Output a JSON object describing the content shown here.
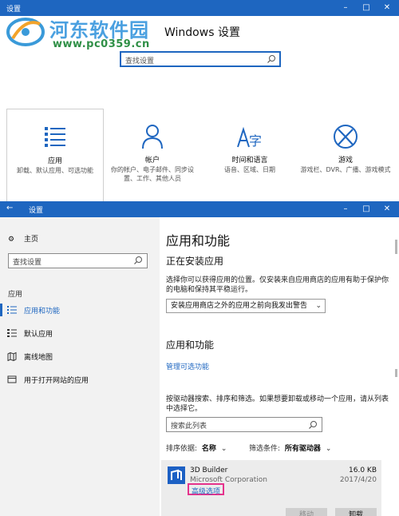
{
  "window1": {
    "title": "设置",
    "heading": "Windows 设置",
    "search_placeholder": "查找设置",
    "categories": [
      {
        "name": "应用",
        "desc": "卸载、默认应用、可选功能",
        "icon": "apps-list-icon"
      },
      {
        "name": "帐户",
        "desc": "你的帐户、电子邮件、同步设置、工作、其他人员",
        "icon": "person-icon"
      },
      {
        "name": "时间和语言",
        "desc": "语音、区域、日期",
        "icon": "time-language-icon"
      },
      {
        "name": "游戏",
        "desc": "游戏栏、DVR、广播、游戏模式",
        "icon": "xbox-icon"
      }
    ]
  },
  "watermark": {
    "name": "河东软件园",
    "url": "www.pc0359.cn"
  },
  "window2": {
    "title": "设置",
    "sidebar": {
      "home": "主页",
      "search_placeholder": "查找设置",
      "section": "应用",
      "items": [
        {
          "label": "应用和功能"
        },
        {
          "label": "默认应用"
        },
        {
          "label": "离线地图"
        },
        {
          "label": "用于打开网站的应用"
        }
      ]
    },
    "content": {
      "title": "应用和功能",
      "installing_heading": "正在安装应用",
      "installing_desc": "选择你可以获得应用的位置。仅安装来自应用商店的应用有助于保护你的电脑和保持其平稳运行。",
      "dropdown_value": "安装应用商店之外的应用之前向我发出警告",
      "apps_heading": "应用和功能",
      "manage_link": "管理可选功能",
      "apps_desc": "按驱动器搜索、排序和筛选。如果想要卸载或移动一个应用，请从列表中选择它。",
      "search_placeholder": "搜索此列表",
      "sort_label": "排序依据:",
      "sort_value": "名称",
      "filter_label": "筛选条件:",
      "filter_value": "所有驱动器",
      "app": {
        "name": "3D Builder",
        "publisher": "Microsoft Corporation",
        "size": "16.0 KB",
        "date": "2017/4/20",
        "advanced_link": "高级选项",
        "move_button": "移动",
        "uninstall_button": "卸载"
      }
    }
  },
  "colors": {
    "titlebar": "#1e66c0",
    "accent": "#1e66c0",
    "highlight_box": "#e5338c"
  }
}
